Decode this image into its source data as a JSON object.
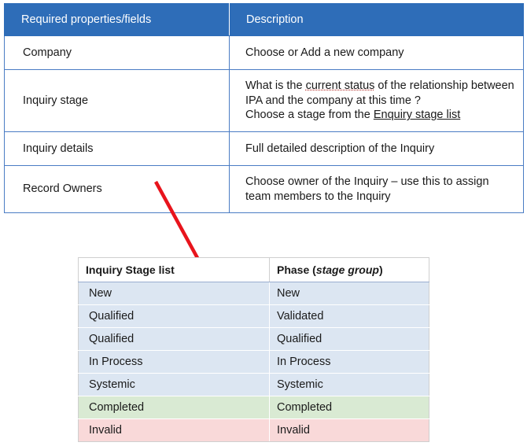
{
  "required_table": {
    "headers": [
      "Required properties/fields",
      "Description"
    ],
    "rows": [
      {
        "field": "Company",
        "description": "Choose or Add a new company"
      },
      {
        "field": "Inquiry stage",
        "description_parts": {
          "p1": "What is the ",
          "p2": "current status",
          "p3": " of the relationship between IPA and the company at this time ?",
          "p4": "Choose a stage from the ",
          "p5": "Enquiry stage list"
        }
      },
      {
        "field": "Inquiry details",
        "description": "Full detailed description of the Inquiry"
      },
      {
        "field": "Record Owners",
        "description": "Choose owner of the Inquiry – use this to assign team members to the Inquiry"
      }
    ]
  },
  "arrow": {
    "color": "#e8141c"
  },
  "stage_table": {
    "header_col1": "Inquiry Stage list",
    "header_col2_prefix": "Phase (",
    "header_col2_italic": "stage group",
    "header_col2_suffix": ")",
    "rows": [
      {
        "stage": "New",
        "phase": "New",
        "tint": "blue"
      },
      {
        "stage": "Qualified",
        "phase": "Validated",
        "tint": "blue"
      },
      {
        "stage": "Qualified",
        "phase": "Qualified",
        "tint": "blue"
      },
      {
        "stage": "In Process",
        "phase": "In Process",
        "tint": "blue"
      },
      {
        "stage": "Systemic",
        "phase": "Systemic",
        "tint": "blue"
      },
      {
        "stage": "Completed",
        "phase": "Completed",
        "tint": "green"
      },
      {
        "stage": "Invalid",
        "phase": "Invalid",
        "tint": "red"
      }
    ],
    "colors": {
      "blue": "#dce6f2",
      "green": "#d9ead3",
      "red": "#f9d9d9"
    }
  }
}
